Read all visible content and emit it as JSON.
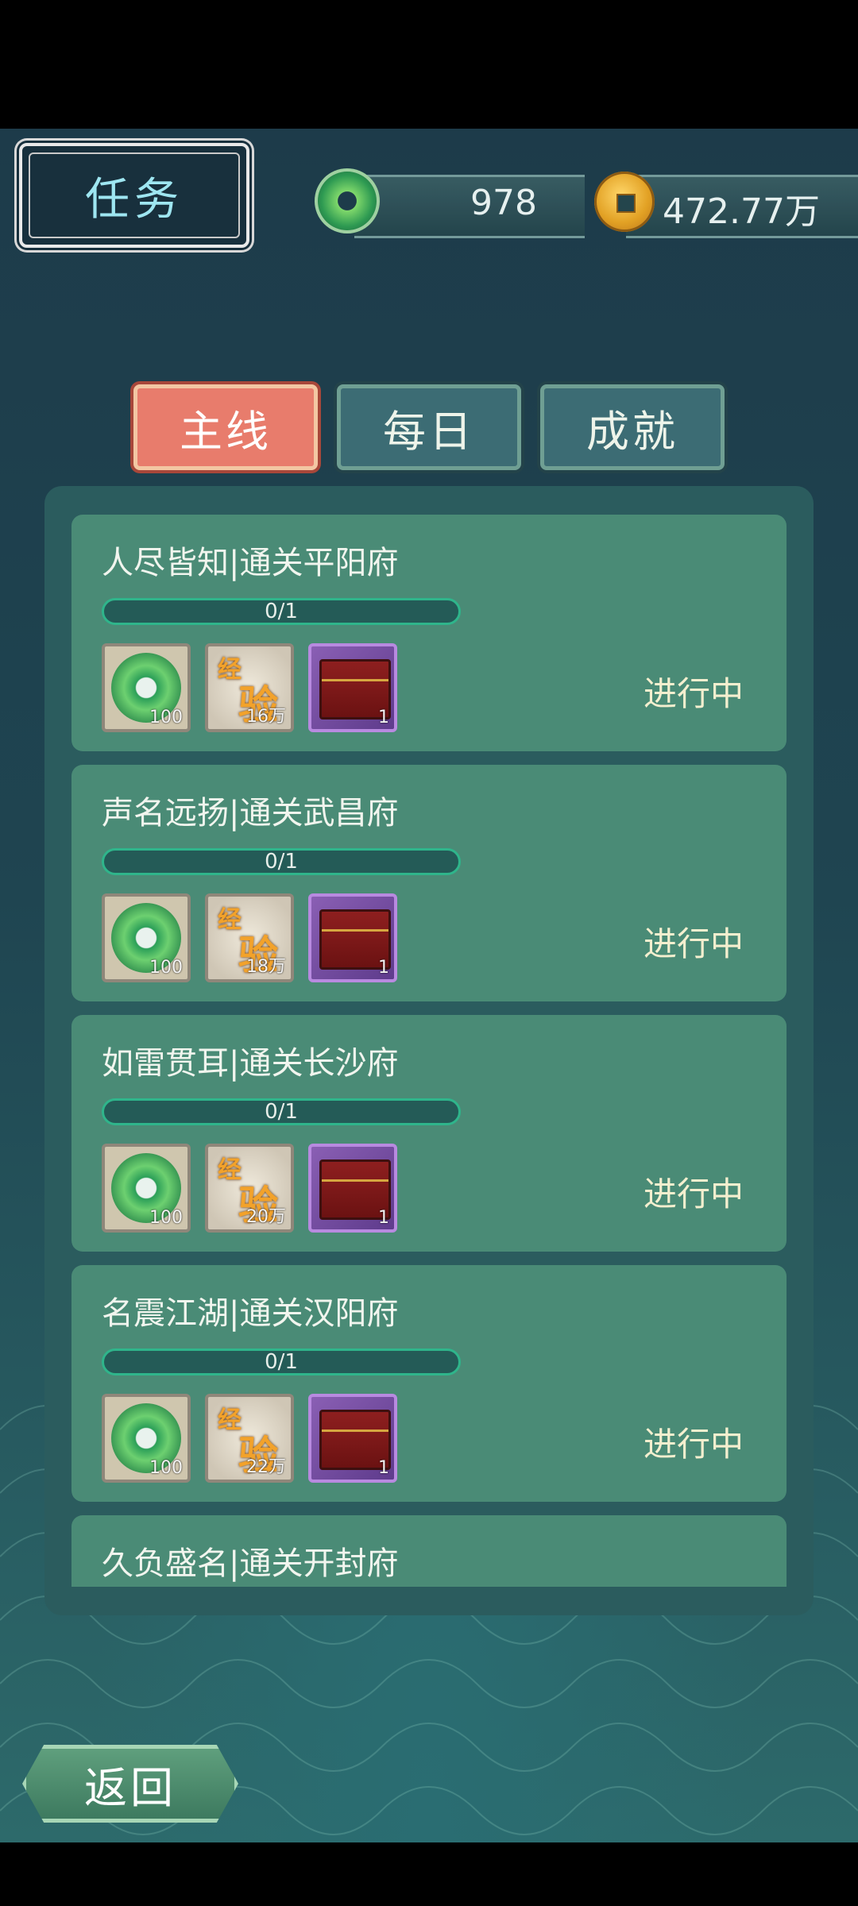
{
  "title": "任务",
  "currency": {
    "jade_value": "978",
    "coin_value": "472.77万"
  },
  "tabs": [
    {
      "label": "主线",
      "active": true
    },
    {
      "label": "每日",
      "active": false
    },
    {
      "label": "成就",
      "active": false
    }
  ],
  "tasks": [
    {
      "title": "人尽皆知|通关平阳府",
      "progress_text": "0/1",
      "progress": 0,
      "rewards": [
        {
          "type": "jade",
          "count": "100"
        },
        {
          "type": "exp",
          "count": "16万"
        },
        {
          "type": "chest",
          "count": "1"
        }
      ],
      "status": "进行中"
    },
    {
      "title": "声名远扬|通关武昌府",
      "progress_text": "0/1",
      "progress": 0,
      "rewards": [
        {
          "type": "jade",
          "count": "100"
        },
        {
          "type": "exp",
          "count": "18万"
        },
        {
          "type": "chest",
          "count": "1"
        }
      ],
      "status": "进行中"
    },
    {
      "title": "如雷贯耳|通关长沙府",
      "progress_text": "0/1",
      "progress": 0,
      "rewards": [
        {
          "type": "jade",
          "count": "100"
        },
        {
          "type": "exp",
          "count": "20万"
        },
        {
          "type": "chest",
          "count": "1"
        }
      ],
      "status": "进行中"
    },
    {
      "title": "名震江湖|通关汉阳府",
      "progress_text": "0/1",
      "progress": 0,
      "rewards": [
        {
          "type": "jade",
          "count": "100"
        },
        {
          "type": "exp",
          "count": "22万"
        },
        {
          "type": "chest",
          "count": "1"
        }
      ],
      "status": "进行中"
    },
    {
      "title": "久负盛名|通关开封府"
    }
  ],
  "exp_icon_text": [
    "经",
    "验"
  ],
  "back_label": "返回"
}
